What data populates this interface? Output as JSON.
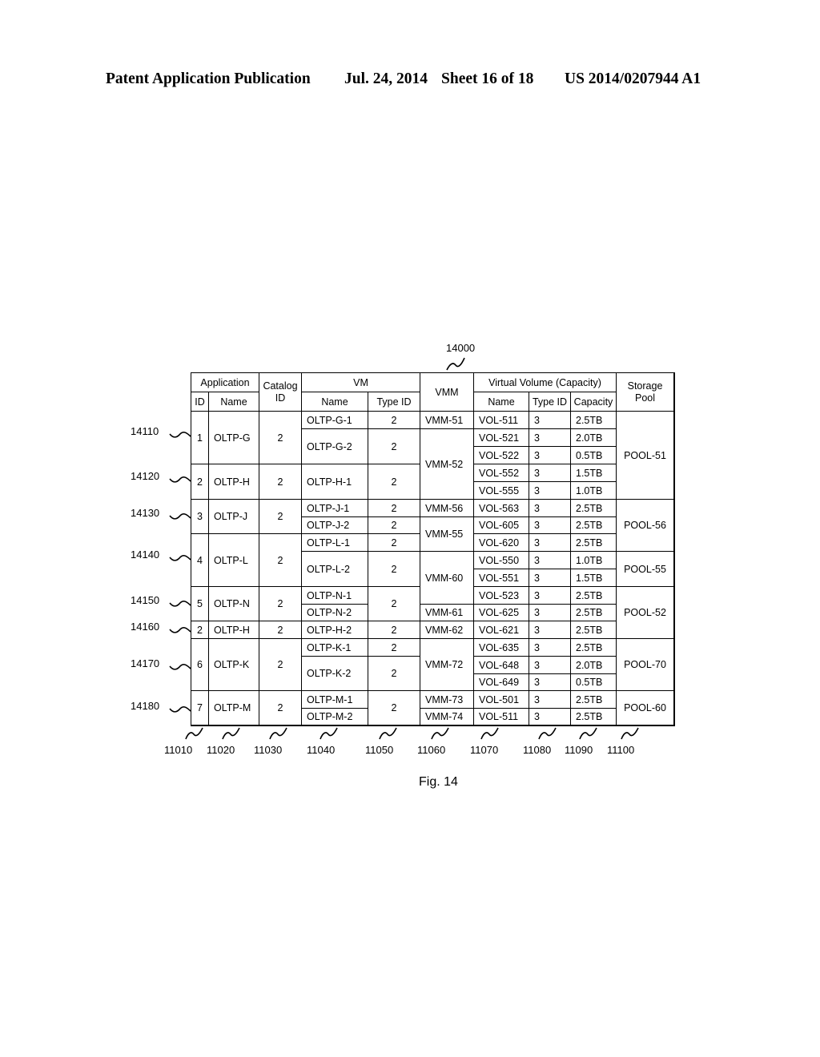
{
  "header": {
    "publication": "Patent Application Publication",
    "date": "Jul. 24, 2014",
    "sheet": "Sheet 16 of 18",
    "number": "US 2014/0207944 A1"
  },
  "figure": {
    "ref": "14000",
    "caption": "Fig. 14"
  },
  "table": {
    "headers": {
      "application": "Application",
      "app_id": "ID",
      "app_name": "Name",
      "catalog_id": "Catalog ID",
      "vm": "VM",
      "vm_name": "Name",
      "vm_type_id": "Type ID",
      "vmm": "VMM",
      "virtual_volume": "Virtual Volume (Capacity)",
      "vol_name": "Name",
      "vol_type_id": "Type ID",
      "vol_capacity": "Capacity",
      "storage_pool": "Storage Pool"
    },
    "groups": [
      {
        "ref": "14110",
        "app_id": "1",
        "app_name": "OLTP-G",
        "catalog_id": "2"
      },
      {
        "ref": "14120",
        "app_id": "2",
        "app_name": "OLTP-H",
        "catalog_id": "2"
      },
      {
        "ref": "14130",
        "app_id": "3",
        "app_name": "OLTP-J",
        "catalog_id": "2"
      },
      {
        "ref": "14140",
        "app_id": "4",
        "app_name": "OLTP-L",
        "catalog_id": "2"
      },
      {
        "ref": "14150",
        "app_id": "5",
        "app_name": "OLTP-N",
        "catalog_id": "2"
      },
      {
        "ref": "14160",
        "app_id": "2",
        "app_name": "OLTP-H",
        "catalog_id": "2"
      },
      {
        "ref": "14170",
        "app_id": "6",
        "app_name": "OLTP-K",
        "catalog_id": "2"
      },
      {
        "ref": "14180",
        "app_id": "7",
        "app_name": "OLTP-M",
        "catalog_id": "2"
      }
    ],
    "vms": [
      {
        "name": "OLTP-G-1",
        "type_id": "2"
      },
      {
        "name": "OLTP-G-2",
        "type_id": "2"
      },
      {
        "name": "OLTP-H-1",
        "type_id": "2"
      },
      {
        "name": "OLTP-J-1",
        "type_id": "2"
      },
      {
        "name": "OLTP-J-2",
        "type_id": "2"
      },
      {
        "name": "OLTP-L-1",
        "type_id": "2"
      },
      {
        "name": "OLTP-L-2",
        "type_id": "2"
      },
      {
        "name": "OLTP-N-1",
        "type_id": ""
      },
      {
        "name": "OLTP-N-2",
        "type_id": ""
      },
      {
        "name": "",
        "type_id": "2"
      },
      {
        "name": "OLTP-H-2",
        "type_id": "2"
      },
      {
        "name": "OLTP-K-1",
        "type_id": "2"
      },
      {
        "name": "OLTP-K-2",
        "type_id": "2"
      },
      {
        "name": "OLTP-M-1",
        "type_id": ""
      },
      {
        "name": "OLTP-M-2",
        "type_id": ""
      },
      {
        "name": "",
        "type_id": "2"
      }
    ],
    "vmms": [
      "VMM-51",
      "VMM-52",
      "VMM-56",
      "VMM-55",
      "VMM-60",
      "VMM-61",
      "VMM-62",
      "VMM-72",
      "VMM-73",
      "VMM-74"
    ],
    "volumes": [
      {
        "name": "VOL-511",
        "type_id": "3",
        "capacity": "2.5TB"
      },
      {
        "name": "VOL-521",
        "type_id": "3",
        "capacity": "2.0TB"
      },
      {
        "name": "VOL-522",
        "type_id": "3",
        "capacity": "0.5TB"
      },
      {
        "name": "VOL-552",
        "type_id": "3",
        "capacity": "1.5TB"
      },
      {
        "name": "VOL-555",
        "type_id": "3",
        "capacity": "1.0TB"
      },
      {
        "name": "VOL-563",
        "type_id": "3",
        "capacity": "2.5TB"
      },
      {
        "name": "VOL-605",
        "type_id": "3",
        "capacity": "2.5TB"
      },
      {
        "name": "VOL-620",
        "type_id": "3",
        "capacity": "2.5TB"
      },
      {
        "name": "VOL-550",
        "type_id": "3",
        "capacity": "1.0TB"
      },
      {
        "name": "VOL-551",
        "type_id": "3",
        "capacity": "1.5TB"
      },
      {
        "name": "VOL-523",
        "type_id": "3",
        "capacity": "2.5TB"
      },
      {
        "name": "VOL-625",
        "type_id": "3",
        "capacity": "2.5TB"
      },
      {
        "name": "VOL-621",
        "type_id": "3",
        "capacity": "2.5TB"
      },
      {
        "name": "VOL-635",
        "type_id": "3",
        "capacity": "2.5TB"
      },
      {
        "name": "VOL-648",
        "type_id": "3",
        "capacity": "2.0TB"
      },
      {
        "name": "VOL-649",
        "type_id": "3",
        "capacity": "0.5TB"
      },
      {
        "name": "VOL-501",
        "type_id": "3",
        "capacity": "2.5TB"
      },
      {
        "name": "VOL-511",
        "type_id": "3",
        "capacity": "2.5TB"
      }
    ],
    "pools": [
      "POOL-51",
      "POOL-56",
      "POOL-55",
      "POOL-52",
      "POOL-70",
      "POOL-60"
    ]
  },
  "column_refs": [
    "11010",
    "11020",
    "11030",
    "11040",
    "11050",
    "11060",
    "11070",
    "11080",
    "11090",
    "11100"
  ]
}
